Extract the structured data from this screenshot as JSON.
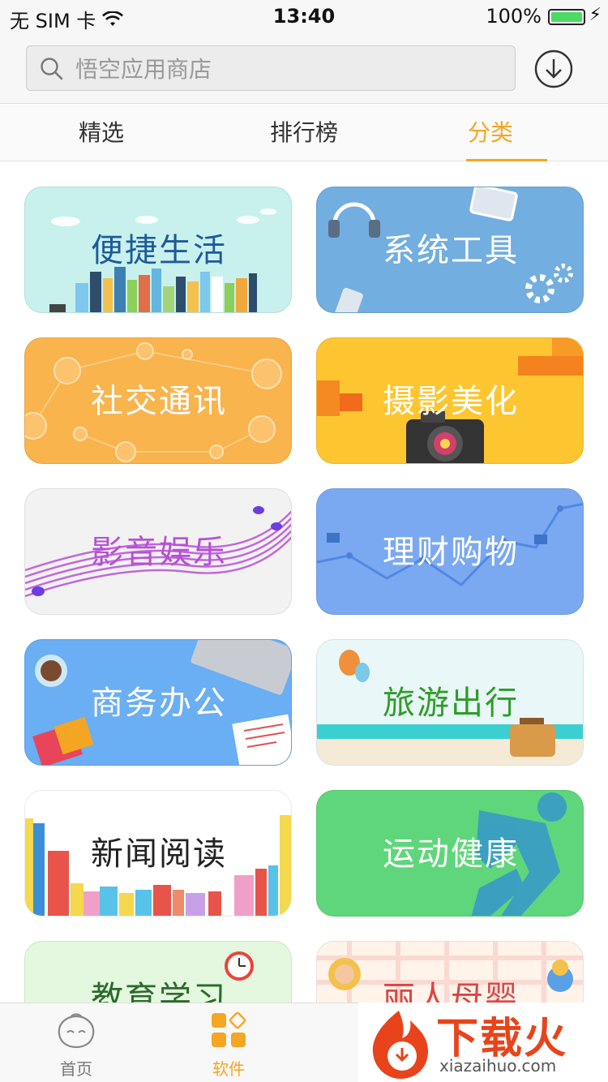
{
  "status_bar": {
    "carrier": "无 SIM 卡",
    "time": "13:40",
    "battery": "100%"
  },
  "search": {
    "placeholder": "悟空应用商店"
  },
  "tabs": [
    {
      "label": "精选",
      "active": false
    },
    {
      "label": "排行榜",
      "active": false
    },
    {
      "label": "分类",
      "active": true
    }
  ],
  "categories": [
    {
      "label": "便捷生活"
    },
    {
      "label": "系统工具"
    },
    {
      "label": "社交通讯"
    },
    {
      "label": "摄影美化"
    },
    {
      "label": "影音娱乐"
    },
    {
      "label": "理财购物"
    },
    {
      "label": "商务办公"
    },
    {
      "label": "旅游出行"
    },
    {
      "label": "新闻阅读"
    },
    {
      "label": "运动健康"
    },
    {
      "label": "教育学习"
    },
    {
      "label": "丽人母婴"
    }
  ],
  "tab_bar": [
    {
      "label": "首页",
      "icon": "monkey-face-icon",
      "active": false
    },
    {
      "label": "软件",
      "icon": "apps-grid-icon",
      "active": true
    }
  ],
  "watermark": {
    "text": "下载火",
    "url": "xiazaihuo.com"
  },
  "colors": {
    "accent": "#f5a623",
    "watermark": "#e8431a"
  }
}
